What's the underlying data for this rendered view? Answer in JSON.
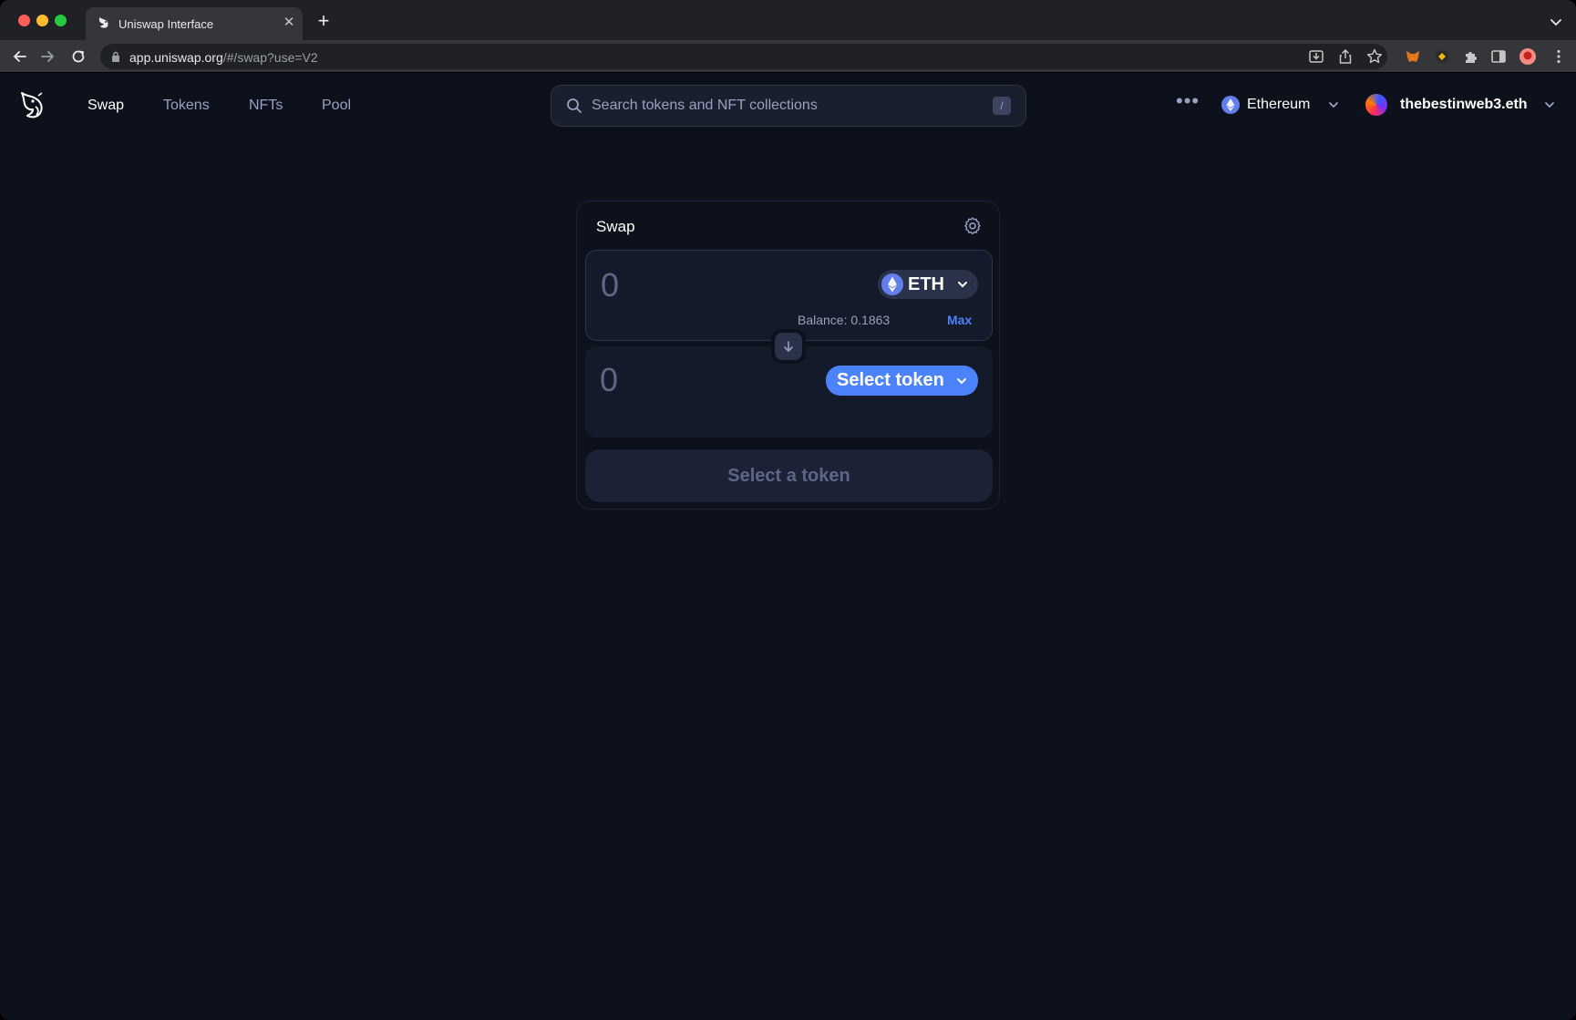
{
  "browser": {
    "tab_title": "Uniswap Interface",
    "tab_close": "✕",
    "new_tab": "+",
    "url_host": "app.uniswap.org",
    "url_path": "/#/swap?use=V2"
  },
  "nav": {
    "links": [
      {
        "label": "Swap",
        "active": true
      },
      {
        "label": "Tokens",
        "active": false
      },
      {
        "label": "NFTs",
        "active": false
      },
      {
        "label": "Pool",
        "active": false
      }
    ],
    "search_placeholder": "Search tokens and NFT collections",
    "search_shortcut": "/",
    "more": "•••",
    "chain": "Ethereum",
    "account": "thebestinweb3.eth"
  },
  "swap": {
    "title": "Swap",
    "input_placeholder": "0",
    "output_placeholder": "0",
    "input_token": "ETH",
    "balance": "Balance: 0.1863",
    "max_label": "Max",
    "select_token_label": "Select token",
    "cta_label": "Select a token"
  },
  "colors": {
    "accent": "#4c82fb",
    "background": "#0d111c",
    "panel": "#131a2a",
    "muted_text": "#98a1c0"
  }
}
